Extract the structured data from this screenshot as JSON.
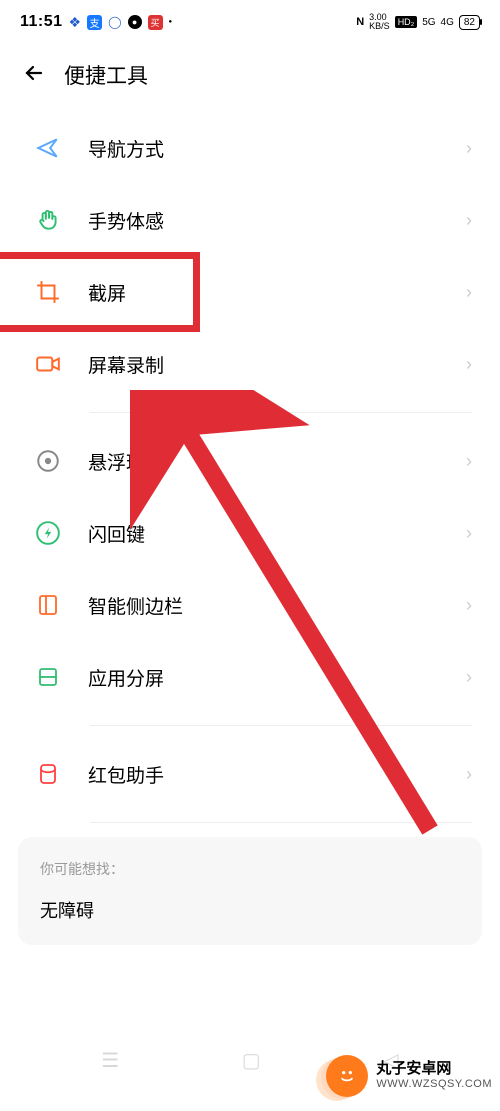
{
  "status": {
    "time": "11:51",
    "kbs_num": "3.00",
    "kbs_unit": "KB/S",
    "hd": "HD",
    "sig1": "5G",
    "sig2": "4G",
    "battery": "82"
  },
  "header": {
    "title": "便捷工具"
  },
  "rows": [
    {
      "label": "导航方式",
      "icon": "nav-arrow",
      "color": "#5aa8ff"
    },
    {
      "label": "手势体感",
      "icon": "hand",
      "color": "#2fbf71"
    },
    {
      "label": "截屏",
      "icon": "crop",
      "color": "#ff6a2b",
      "highlight": true
    },
    {
      "label": "屏幕录制",
      "icon": "video",
      "color": "#ff6a2b"
    },
    {
      "label": "悬浮球",
      "icon": "target",
      "color": "#888"
    },
    {
      "label": "闪回键",
      "icon": "bolt-circle",
      "color": "#2fbf71"
    },
    {
      "label": "智能侧边栏",
      "icon": "side-panel",
      "color": "#ff6a2b"
    },
    {
      "label": "应用分屏",
      "icon": "split",
      "color": "#2fbf71"
    },
    {
      "label": "红包助手",
      "icon": "red-packet",
      "color": "#ff4040"
    }
  ],
  "dividers_after": [
    3,
    7
  ],
  "suggestions": {
    "hint": "你可能想找：",
    "item": "无障碍"
  },
  "watermark": {
    "line1": "丸子安卓网",
    "line2": "WWW.WZSQSY.COM"
  }
}
